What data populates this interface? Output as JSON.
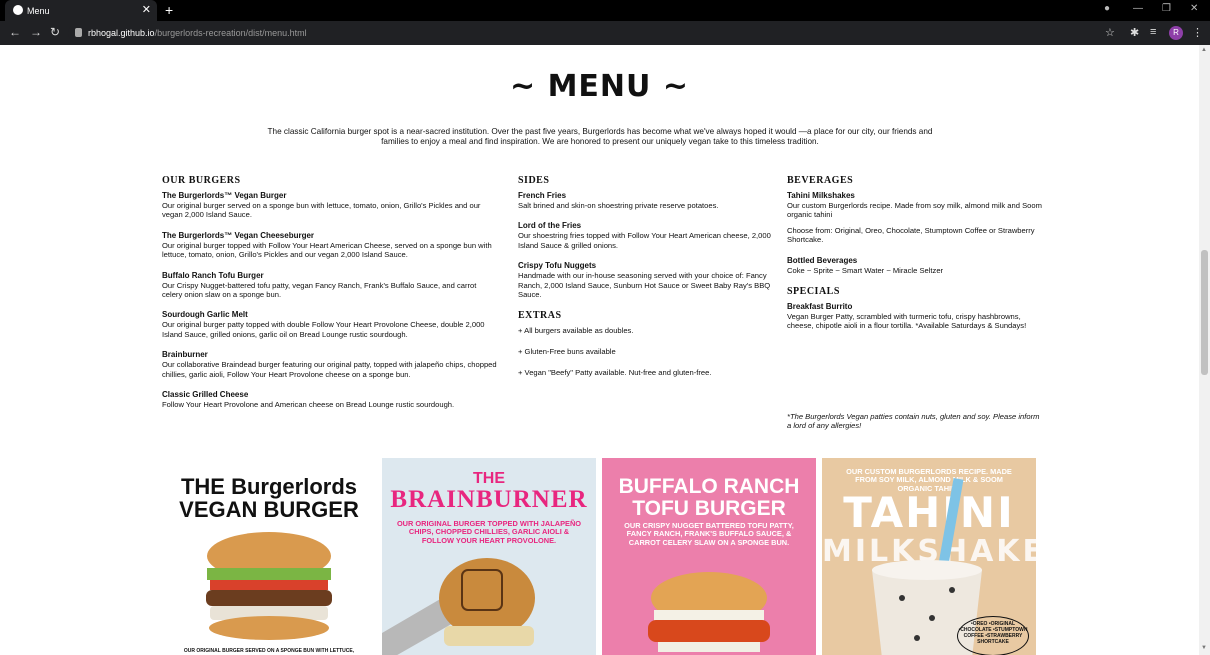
{
  "browser": {
    "tab_title": "Menu",
    "url_host": "rbhogal.github.io",
    "url_path": "/burgerlords-recreation/dist/menu.html",
    "profile_initial": "R"
  },
  "page": {
    "title": "~ MENU ~",
    "intro": "The classic California burger spot is a near-sacred institution. Over the past five years, Burgerlords has become what we've always hoped it would —a place for our city, our friends and families to enjoy a meal and find inspiration. We are honored to present our uniquely vegan take to this timeless tradition.",
    "burgers": {
      "heading": "OUR BURGERS",
      "items": [
        {
          "name": "The Burgerlords™ Vegan Burger",
          "desc": "Our original burger served on a sponge bun with lettuce, tomato, onion, Grillo's Pickles and our vegan 2,000 Island Sauce."
        },
        {
          "name": "The Burgerlords™ Vegan Cheeseburger",
          "desc": "Our original burger topped with Follow Your Heart American Cheese, served on a sponge bun with lettuce, tomato, onion, Grillo's Pickles and our vegan 2,000 Island Sauce."
        },
        {
          "name": "Buffalo Ranch Tofu Burger",
          "desc": "Our Crispy Nugget-battered tofu patty, vegan Fancy Ranch, Frank's Buffalo Sauce, and carrot celery onion slaw on a sponge bun."
        },
        {
          "name": "Sourdough Garlic Melt",
          "desc": "Our original burger patty topped with double Follow Your Heart Provolone Cheese, double 2,000 Island Sauce, grilled onions, garlic oil on Bread Lounge rustic sourdough."
        },
        {
          "name": "Brainburner",
          "desc": "Our collaborative Braindead burger featuring our original patty, topped with jalapeño chips, chopped chillies, garlic aioli, Follow Your Heart Provolone cheese on a sponge bun."
        },
        {
          "name": "Classic Grilled Cheese",
          "desc": "Follow Your Heart Provolone and American cheese on Bread Lounge rustic sourdough."
        }
      ]
    },
    "sides": {
      "heading": "SIDES",
      "items": [
        {
          "name": "French Fries",
          "desc": "Salt brined and skin-on shoestring private reserve potatoes."
        },
        {
          "name": "Lord of the Fries",
          "desc": "Our shoestring fries topped with Follow Your Heart American cheese, 2,000 Island Sauce & grilled onions."
        },
        {
          "name": "Crispy Tofu Nuggets",
          "desc": "Handmade with our in-house seasoning served with your choice of: Fancy Ranch, 2,000 Island Sauce, Sunburn Hot Sauce or Sweet Baby Ray's BBQ Sauce."
        }
      ]
    },
    "extras": {
      "heading": "EXTRAS",
      "items": [
        "+ All burgers available as doubles.",
        "+ Gluten-Free buns available",
        "+ Vegan \"Beefy\" Patty available. Nut-free and gluten-free."
      ]
    },
    "beverages": {
      "heading": "BEVERAGES",
      "items": [
        {
          "name": "Tahini Milkshakes",
          "desc": "Our custom Burgerlords recipe. Made from soy milk, almond milk and Soom organic tahini",
          "desc2": "Choose from: Original, Oreo, Chocolate, Stumptown Coffee or Strawberry Shortcake."
        },
        {
          "name": "Bottled Beverages",
          "desc": "Coke ~ Sprite ~ Smart Water ~ Miracle Seltzer"
        }
      ]
    },
    "specials": {
      "heading": "SPECIALS",
      "items": [
        {
          "name": "Breakfast Burrito",
          "desc": "Vegan Burger Patty, scrambled with turmeric tofu, crispy hashbrowns, cheese, chipotle aioli in a flour tortilla. *Available Saturdays & Sundays!"
        }
      ]
    },
    "note": "*The Burgerlords Vegan patties contain nuts, gluten and soy. Please inform a lord of any allergies!"
  },
  "cards": [
    {
      "title_line1": "THE Burgerlords",
      "title_line2": "VEGAN BURGER",
      "footer": "OUR ORIGINAL BURGER SERVED ON A SPONGE BUN WITH LETTUCE,"
    },
    {
      "title_line1": "THE",
      "title_line2": "BRAINBURNER",
      "sub": "OUR ORIGINAL BURGER TOPPED WITH JALAPEÑO CHIPS, CHOPPED CHILLIES, GARLIC AIOLI & FOLLOW YOUR HEART PROVOLONE."
    },
    {
      "title_line1": "BUFFALO RANCH",
      "title_line2": "TOFU BURGER",
      "sub": "OUR CRISPY NUGGET BATTERED TOFU PATTY, FANCY RANCH, FRANK'S BUFFALO SAUCE, & CARROT CELERY SLAW ON A SPONGE BUN."
    },
    {
      "sub": "OUR CUSTOM BURGERLORDS RECIPE. MADE FROM SOY MILK, ALMOND MILK & SOOM ORGANIC TAHINI.",
      "title_line1": "TAHINI",
      "title_line2": "MILKSHAKE",
      "flavors": "•OREO •ORIGINAL •CHOCOLATE •STUMPTOWN COFFEE •STRAWBERRY SHORTCAKE"
    }
  ],
  "colors": {
    "pink": "#e8267f",
    "pink_bg": "#ec7fab",
    "tan_bg": "#e8c9a2",
    "blue_bg": "#dde8ef"
  }
}
